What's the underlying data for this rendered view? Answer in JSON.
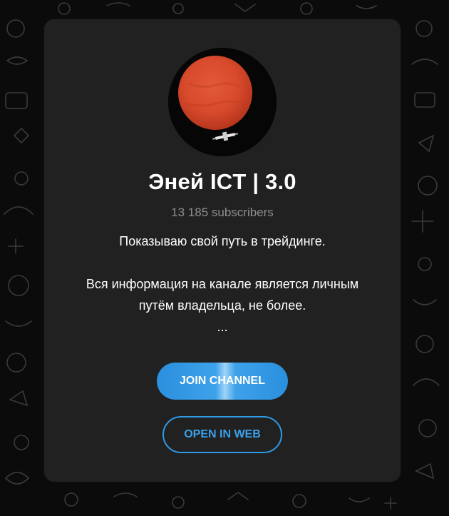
{
  "channel": {
    "title": "Эней ICT | 3.0",
    "subscribers": "13 185 subscribers",
    "description_lines": [
      "Показываю свой путь в трейдинге.",
      "",
      "Вся информация на канале является личным",
      "путём владельца, не более.",
      "..."
    ]
  },
  "actions": {
    "join_label": "JOIN CHANNEL",
    "web_label": "OPEN IN WEB"
  },
  "colors": {
    "accent": "#3aa0ea",
    "card": "#212121",
    "background": "#0b0b0b"
  },
  "icons": {
    "avatar": "red-planet-satellite-avatar"
  }
}
